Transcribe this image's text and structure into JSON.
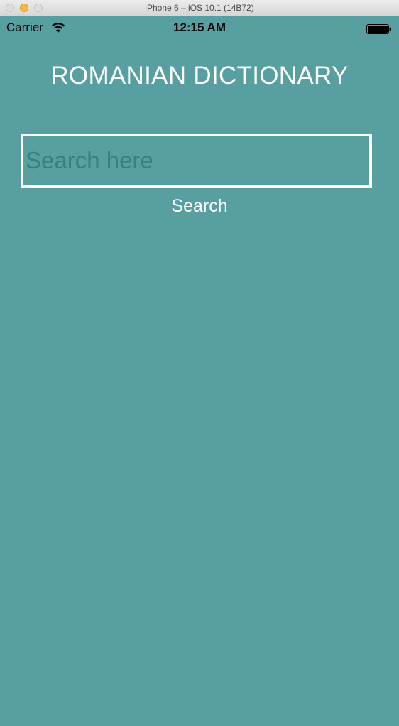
{
  "window": {
    "title": "iPhone 6 – iOS 10.1 (14B72)"
  },
  "status_bar": {
    "carrier": "Carrier",
    "time": "12:15 AM",
    "icons": [
      "wifi-icon",
      "battery-icon"
    ]
  },
  "app": {
    "title": "ROMANIAN DICTIONARY",
    "search": {
      "placeholder": "Search here",
      "value": ""
    },
    "search_button_label": "Search"
  },
  "colors": {
    "background": "#579fa1",
    "text": "#ffffff",
    "placeholder": "#3b7e80",
    "border": "#ffffff"
  }
}
